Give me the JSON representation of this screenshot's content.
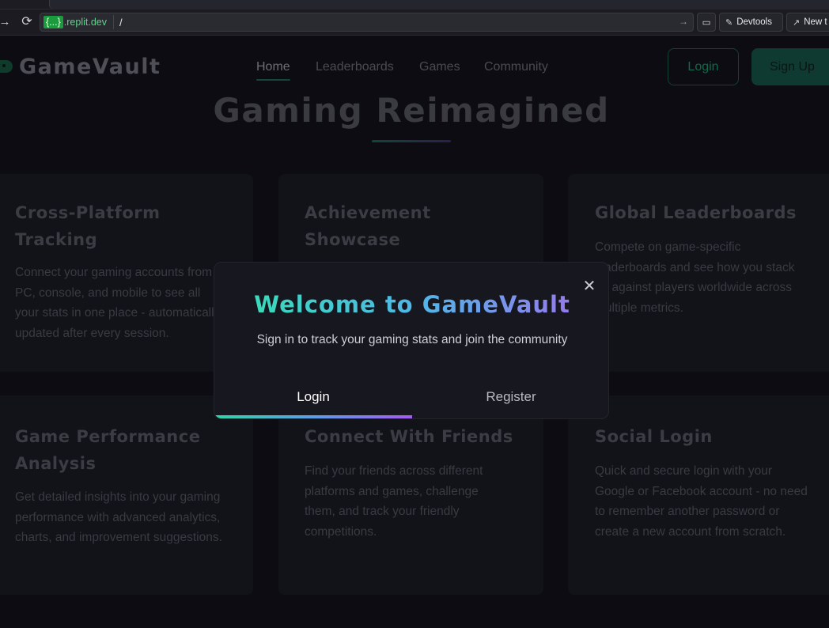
{
  "browser": {
    "host_badge": "{...}",
    "host_domain": ".replit.dev",
    "path": "/",
    "devtools_label": "Devtools",
    "newtab_label": "New t"
  },
  "site": {
    "brand": "GameVault",
    "nav": [
      {
        "label": "Home",
        "active": true
      },
      {
        "label": "Leaderboards",
        "active": false
      },
      {
        "label": "Games",
        "active": false
      },
      {
        "label": "Community",
        "active": false
      }
    ],
    "login_label": "Login",
    "signup_label": "Sign Up",
    "hero_title": "Gaming Reimagined"
  },
  "features": [
    {
      "title": "Cross-Platform Tracking",
      "text": "Connect your gaming accounts from PC, console, and mobile to see all your stats in one place - automatically updated after every session."
    },
    {
      "title": "Achievement Showcase",
      "text": ""
    },
    {
      "title": "Global Leaderboards",
      "text": "Compete on game-specific leaderboards and see how you stack up against players worldwide across multiple metrics."
    },
    {
      "title": "Game Performance Analysis",
      "text": "Get detailed insights into your gaming performance with advanced analytics, charts, and improvement suggestions."
    },
    {
      "title": "Connect With Friends",
      "text": "Find your friends across different platforms and games, challenge them, and track your friendly competitions."
    },
    {
      "title": "Social Login",
      "text": "Quick and secure login with your Google or Facebook account - no need to remember another password or create a new account from scratch."
    }
  ],
  "modal": {
    "title": "Welcome to GameVault",
    "subtitle": "Sign in to track your gaming stats and join the community",
    "tabs": [
      "Login",
      "Register"
    ],
    "active_tab": "Login",
    "close_icon": "close-icon"
  },
  "colors": {
    "accent_green": "#34e3b0",
    "accent_purple": "#a56cf0",
    "background": "#0d0d13"
  }
}
